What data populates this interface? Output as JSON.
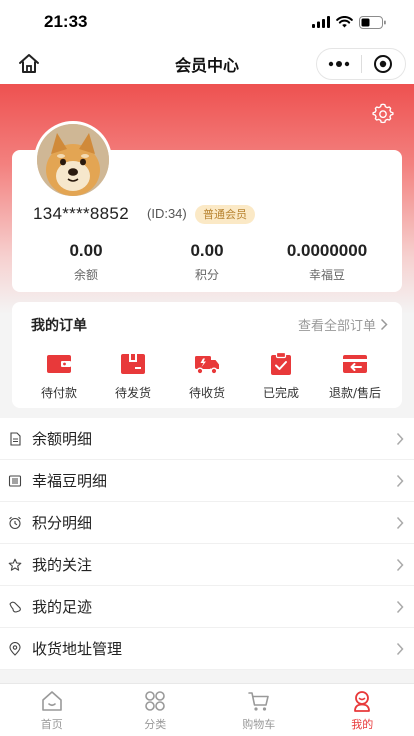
{
  "status_bar": {
    "time": "21:33"
  },
  "nav": {
    "title": "会员中心"
  },
  "user": {
    "phone": "134****8852",
    "id_text": "(ID:34)",
    "badge": "普通会员"
  },
  "stats": [
    {
      "value": "0.00",
      "label": "余额"
    },
    {
      "value": "0.00",
      "label": "积分"
    },
    {
      "value": "0.0000000",
      "label": "幸福豆"
    }
  ],
  "orders": {
    "title": "我的订单",
    "view_all": "查看全部订单",
    "items": [
      {
        "label": "待付款",
        "icon": "wallet-icon"
      },
      {
        "label": "待发货",
        "icon": "package-icon"
      },
      {
        "label": "待收货",
        "icon": "truck-icon"
      },
      {
        "label": "已完成",
        "icon": "clipboard-check-icon"
      },
      {
        "label": "退款/售后",
        "icon": "return-icon"
      }
    ]
  },
  "menu": [
    {
      "label": "余额明细",
      "icon": "document-icon"
    },
    {
      "label": "幸福豆明细",
      "icon": "list-icon"
    },
    {
      "label": "积分明细",
      "icon": "alarm-clock-icon"
    },
    {
      "label": "我的关注",
      "icon": "star-icon"
    },
    {
      "label": "我的足迹",
      "icon": "footprint-icon"
    },
    {
      "label": "收货地址管理",
      "icon": "location-pin-icon"
    }
  ],
  "tabs": [
    {
      "label": "首页",
      "icon": "home-icon",
      "active": false
    },
    {
      "label": "分类",
      "icon": "grid-icon",
      "active": false
    },
    {
      "label": "购物车",
      "icon": "cart-icon",
      "active": false
    },
    {
      "label": "我的",
      "icon": "profile-icon",
      "active": true
    }
  ],
  "colors": {
    "accent": "#e8393a",
    "badge_bg": "#fbe9c6",
    "badge_text": "#b88330"
  }
}
